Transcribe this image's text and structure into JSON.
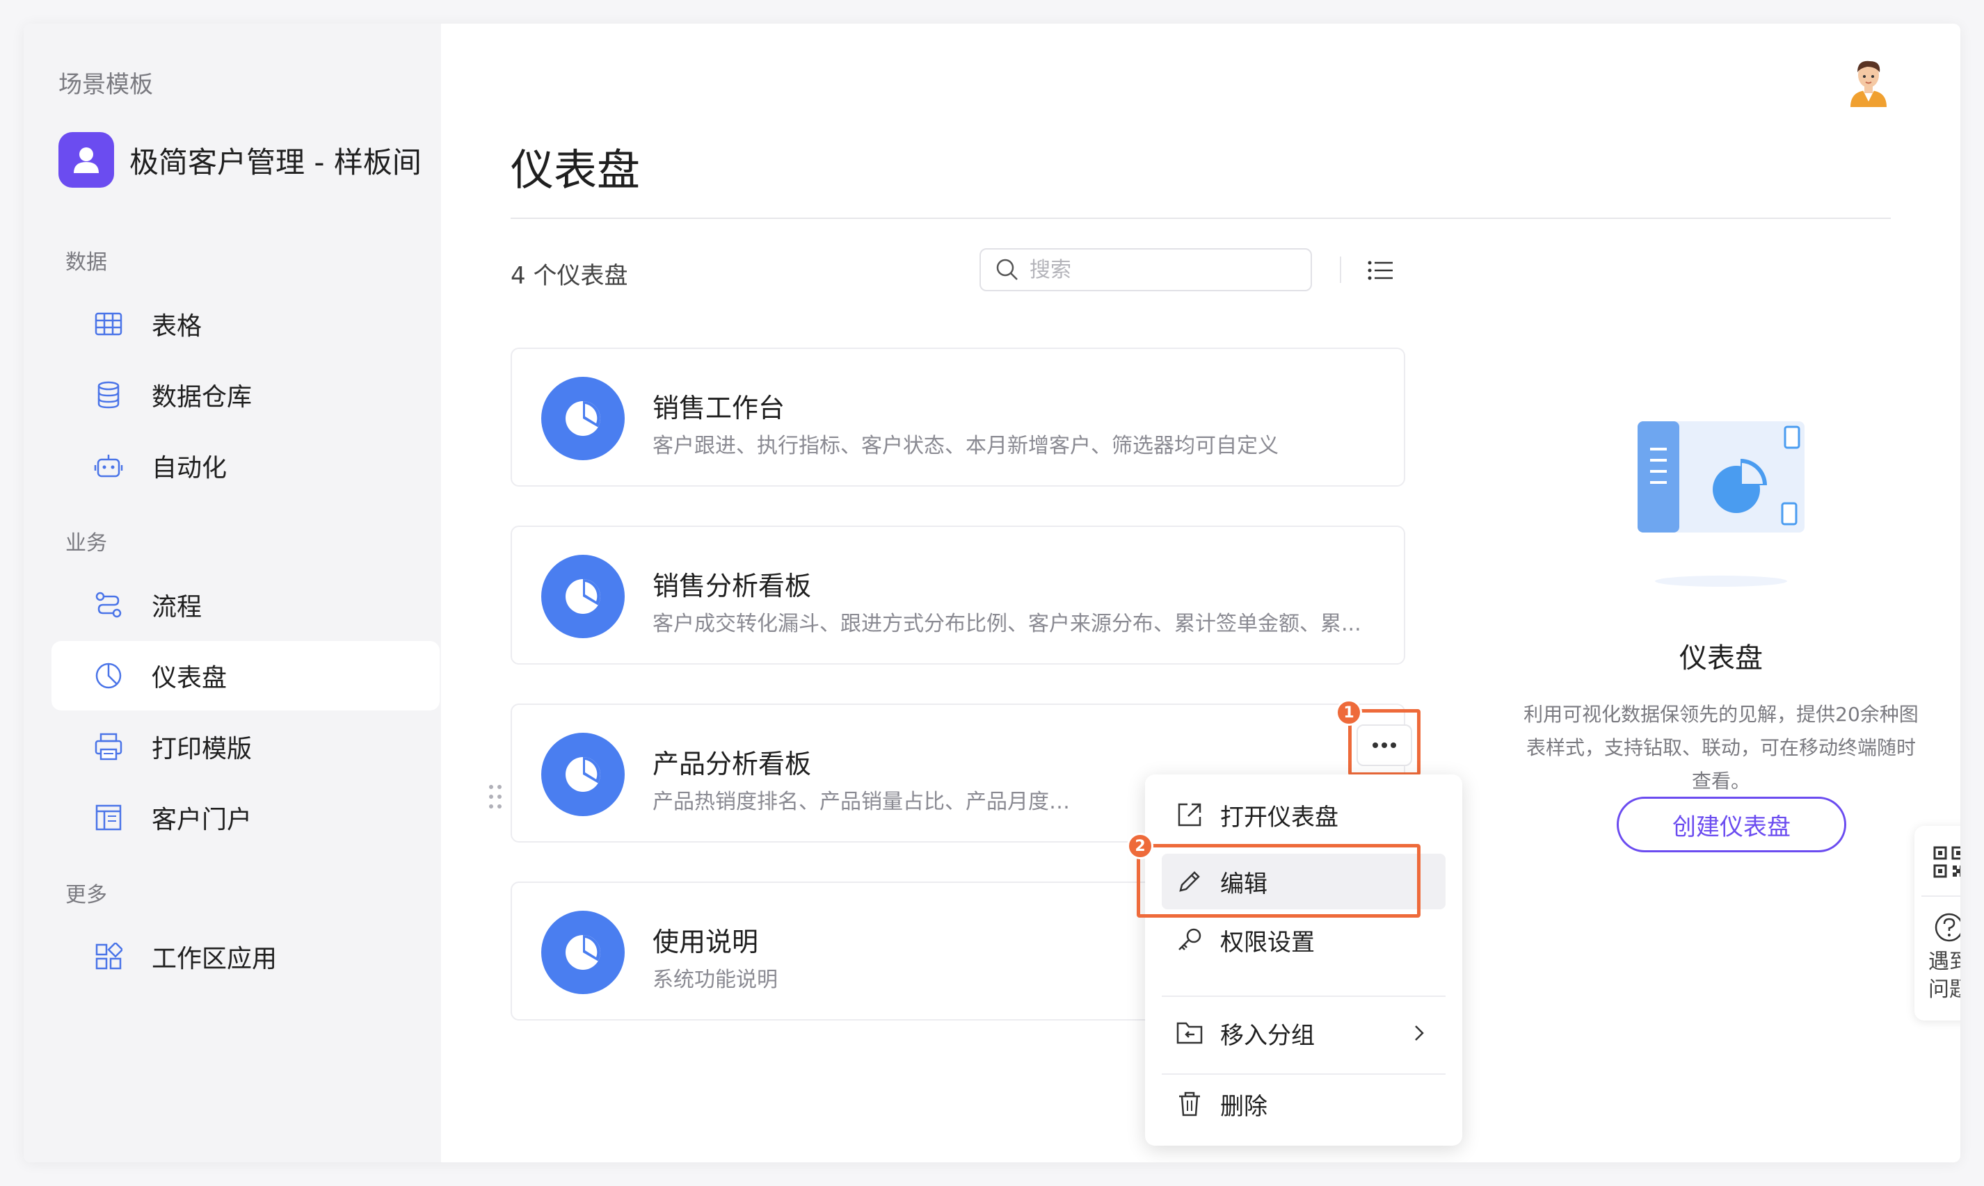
{
  "sidebar": {
    "breadcrumb": "场景模板",
    "app_name": "极简客户管理 - 样板间",
    "sections": [
      {
        "label": "数据",
        "items": [
          {
            "label": "表格",
            "icon": "table-icon"
          },
          {
            "label": "数据仓库",
            "icon": "database-icon"
          },
          {
            "label": "自动化",
            "icon": "robot-icon"
          }
        ]
      },
      {
        "label": "业务",
        "items": [
          {
            "label": "流程",
            "icon": "workflow-icon"
          },
          {
            "label": "仪表盘",
            "icon": "dashboard-icon",
            "active": true
          },
          {
            "label": "打印模版",
            "icon": "printer-icon"
          },
          {
            "label": "客户门户",
            "icon": "portal-icon"
          }
        ]
      },
      {
        "label": "更多",
        "items": [
          {
            "label": "工作区应用",
            "icon": "apps-icon"
          }
        ]
      }
    ]
  },
  "main": {
    "title": "仪表盘",
    "count_text": "4 个仪表盘",
    "search_placeholder": "搜索",
    "cards": [
      {
        "title": "销售工作台",
        "desc": "客户跟进、执行指标、客户状态、本月新增客户、筛选器均可自定义"
      },
      {
        "title": "销售分析看板",
        "desc": "客户成交转化漏斗、跟进方式分布比例、客户来源分布、累计签单金额、累..."
      },
      {
        "title": "产品分析看板",
        "desc": "产品热销度排名、产品销量占比、产品月度销售"
      },
      {
        "title": "使用说明",
        "desc": "系统功能说明"
      }
    ],
    "menu": {
      "items": [
        {
          "label": "打开仪表盘",
          "icon": "open-external-icon"
        },
        {
          "label": "编辑",
          "icon": "pencil-icon"
        },
        {
          "label": "权限设置",
          "icon": "key-icon"
        },
        {
          "label": "移入分组",
          "icon": "move-folder-icon"
        },
        {
          "label": "删除",
          "icon": "trash-icon"
        }
      ]
    },
    "step_badges": [
      "1",
      "2"
    ]
  },
  "right_panel": {
    "title": "仪表盘",
    "description": "利用可视化数据保领先的见解，提供20余种图表样式，支持钻取、联动，可在移动终端随时查看。",
    "create_button": "创建仪表盘"
  },
  "help_float": {
    "label": "遇到问题"
  },
  "colors": {
    "accent_purple": "#6b4cf0",
    "card_icon_blue": "#4a7ef0",
    "highlight_orange": "#ee6a3a",
    "sidebar_icon_blue": "#4a74e8"
  }
}
